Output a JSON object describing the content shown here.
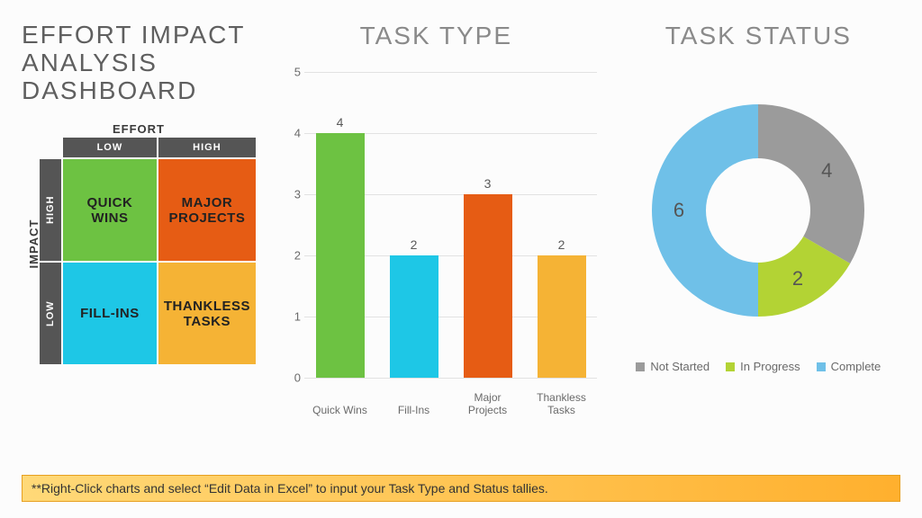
{
  "title": "EFFORT IMPACT ANALYSIS DASHBOARD",
  "matrix": {
    "effort_label": "EFFORT",
    "impact_label": "IMPACT",
    "cols": [
      "LOW",
      "HIGH"
    ],
    "rows": [
      "HIGH",
      "LOW"
    ],
    "cells": {
      "quick_wins": "QUICK WINS",
      "major_projects": "MAJOR PROJECTS",
      "fill_ins": "FILL-INS",
      "thankless_tasks": "THANKLESS TASKS"
    }
  },
  "task_type_title": "TASK TYPE",
  "task_status_title": "TASK STATUS",
  "footer_note": "**Right-Click charts and select “Edit Data in Excel” to input your Task Type and Status tallies.",
  "colors": {
    "quick_wins": "#6dc242",
    "fill_ins": "#1ec7e6",
    "major_projects": "#e65c14",
    "thankless_tasks": "#f5b335",
    "not_started": "#9b9b9b",
    "in_progress": "#b3d334",
    "complete": "#6fc0e8"
  },
  "chart_data": [
    {
      "type": "bar",
      "title": "TASK TYPE",
      "categories": [
        "Quick Wins",
        "Fill-Ins",
        "Major Projects",
        "Thankless Tasks"
      ],
      "values": [
        4,
        2,
        3,
        2
      ],
      "colors": [
        "#6dc242",
        "#1ec7e6",
        "#e65c14",
        "#f5b335"
      ],
      "ylim": [
        0,
        5
      ],
      "yticks": [
        0,
        1,
        2,
        3,
        4,
        5
      ],
      "xlabel": "",
      "ylabel": ""
    },
    {
      "type": "pie",
      "title": "TASK STATUS",
      "donut": true,
      "series": [
        {
          "name": "Not Started",
          "value": 4,
          "color": "#9b9b9b"
        },
        {
          "name": "In Progress",
          "value": 2,
          "color": "#b3d334"
        },
        {
          "name": "Complete",
          "value": 6,
          "color": "#6fc0e8"
        }
      ],
      "legend_position": "bottom"
    }
  ]
}
